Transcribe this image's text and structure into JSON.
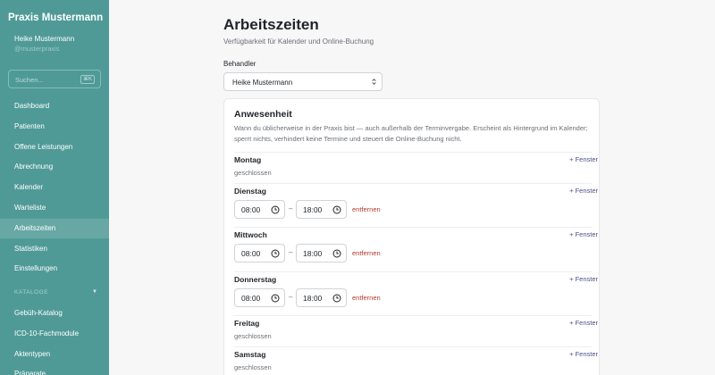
{
  "sidebar": {
    "brand": "Praxis Mustermann",
    "user_name": "Heike Mustermann",
    "user_handle": "@musterpraxis",
    "search_placeholder": "Suchen...",
    "search_shortcut": "⌘K",
    "items": [
      {
        "label": "Dashboard"
      },
      {
        "label": "Patienten"
      },
      {
        "label": "Offene Leistungen"
      },
      {
        "label": "Abrechnung"
      },
      {
        "label": "Kalender"
      },
      {
        "label": "Warteliste"
      },
      {
        "label": "Arbeitszeiten",
        "active": true
      },
      {
        "label": "Statistiken"
      },
      {
        "label": "Einstellungen"
      }
    ],
    "section_label": "KATALOGE",
    "catalog_items": [
      {
        "label": "Gebüh-Katalog"
      },
      {
        "label": "ICD-10-Fachmodule"
      },
      {
        "label": "Aktentypen"
      },
      {
        "label": "Präparate"
      }
    ]
  },
  "main": {
    "title": "Arbeitszeiten",
    "subtitle": "Verfügbarkeit für Kalender und Online-Buchung",
    "practitioner_label": "Behandler",
    "practitioner_value": "Heike Mustermann"
  },
  "card": {
    "title": "Anwesenheit",
    "description": "Wann du üblicherweise in der Praxis bist — auch außerhalb der Terminvergabe. Erscheint als Hintergrund im Kalender; sperrt nichts, verhindert keine Termine und steuert die Online-Buchung nicht.",
    "add_label": "+ Fenster",
    "remove_label": "entfernen",
    "closed_label": "geschlossen",
    "days": {
      "montag": {
        "name": "Montag"
      },
      "dienstag": {
        "name": "Dienstag",
        "start": "08:00",
        "end": "18:00"
      },
      "mittwoch": {
        "name": "Mittwoch",
        "start": "08:00",
        "end": "18:00"
      },
      "donnerstag": {
        "name": "Donnerstag",
        "start": "08:00",
        "end": "18:00"
      },
      "freitag": {
        "name": "Freitag"
      },
      "samstag": {
        "name": "Samstag"
      }
    }
  },
  "colors": {
    "sidebar_bg": "#4f9a97",
    "accent_link": "#4a4f8a",
    "remove_link": "#b03a2e"
  }
}
